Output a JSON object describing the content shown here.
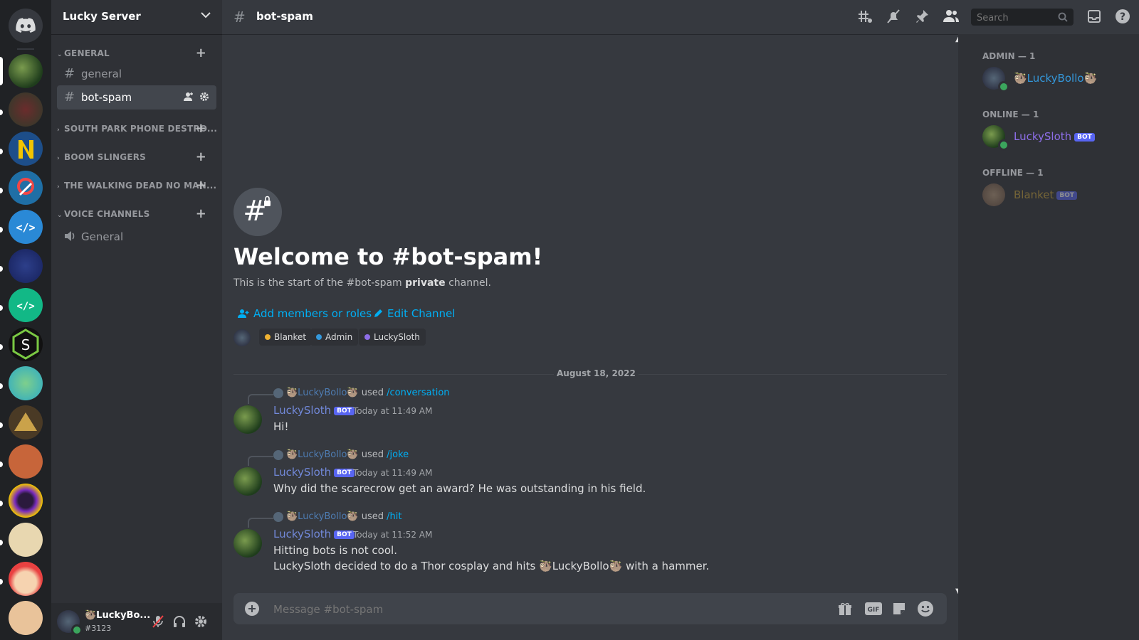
{
  "server": {
    "name": "Lucky Server"
  },
  "categories": [
    {
      "label": "GENERAL"
    },
    {
      "label": "SOUTH PARK PHONE DESTRO..."
    },
    {
      "label": "BOOM SLINGERS"
    },
    {
      "label": "THE WALKING DEAD NO MAN..."
    },
    {
      "label": "VOICE CHANNELS"
    }
  ],
  "channels": [
    {
      "name": "general"
    },
    {
      "name": "bot-spam"
    },
    {
      "name": "General"
    }
  ],
  "user": {
    "name": "🦥LuckyBo...",
    "tag": "#3123"
  },
  "topbar": {
    "channel": "bot-spam",
    "search_placeholder": "Search"
  },
  "welcome": {
    "title": "Welcome to #bot-spam!",
    "subtitle_pre": "This is the start of the #bot-spam ",
    "subtitle_bold": "private",
    "subtitle_post": " channel.",
    "add_members": "Add members or roles",
    "edit_channel": "Edit Channel",
    "roles": [
      {
        "name": "Blanket",
        "color": "#f0b232"
      },
      {
        "name": "Admin",
        "color": "#3498db"
      },
      {
        "name": "LuckySloth",
        "color": "#8d6ee8"
      }
    ]
  },
  "date_divider": "August 18, 2022",
  "messages": [
    {
      "reply_user": "🦥LuckyBollo🦥",
      "reply_used": "used",
      "reply_cmd": "/conversation",
      "author": "LuckySloth",
      "bot": "BOT",
      "time": "Today at 11:49 AM",
      "lines": [
        "Hi!"
      ]
    },
    {
      "reply_user": "🦥LuckyBollo🦥",
      "reply_used": "used",
      "reply_cmd": "/joke",
      "author": "LuckySloth",
      "bot": "BOT",
      "time": "Today at 11:49 AM",
      "lines": [
        "Why did the scarecrow get an award? He was outstanding in his field."
      ]
    },
    {
      "reply_user": "🦥LuckyBollo🦥",
      "reply_used": "used",
      "reply_cmd": "/hit",
      "author": "LuckySloth",
      "bot": "BOT",
      "time": "Today at 11:52 AM",
      "lines": [
        "Hitting bots is not cool.",
        "LuckySloth decided to do a Thor cosplay and hits 🦥LuckyBollo🦥 with a hammer."
      ]
    }
  ],
  "composer": {
    "placeholder": "Message #bot-spam"
  },
  "members": {
    "groups": [
      {
        "label": "ADMIN — 1",
        "members": [
          {
            "name": "🦥LuckyBollo🦥",
            "color": "#3498db",
            "bot": ""
          }
        ]
      },
      {
        "label": "ONLINE — 1",
        "members": [
          {
            "name": "LuckySloth",
            "color": "#8d6ee8",
            "bot": "BOT"
          }
        ]
      },
      {
        "label": "OFFLINE — 1",
        "members": [
          {
            "name": "Blanket",
            "color": "#8a6d2b",
            "bot": "BOT"
          }
        ]
      }
    ]
  },
  "colors": {
    "blurple": "#5865f2",
    "link": "#00aff4",
    "online": "#3ba55d"
  }
}
